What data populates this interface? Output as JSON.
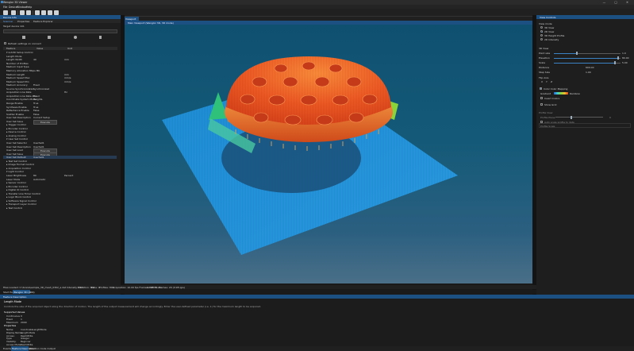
{
  "window": {
    "title": "Wenglor 3D Viewer",
    "controls": [
      "—",
      "□",
      "✕"
    ]
  },
  "menu": [
    "File",
    "Device",
    "Window",
    "Help"
  ],
  "left_panel": {
    "header": "Device Info",
    "tabs": [
      "Scanner",
      "Properties",
      "Feature Explorer"
    ],
    "target_label": "Target device",
    "target_value": "101",
    "search_placeholder": "",
    "toolbar_icons": [
      "save-icon",
      "load-icon",
      "execute-icon",
      "download-icon"
    ],
    "checkbox_label": "Refresh settings on connect",
    "columns": [
      "Feature",
      "Value",
      "Unit"
    ],
    "rows": [
      {
        "name": "▾ LLS3D Setup Control",
        "value": "",
        "unit": ""
      },
      {
        "name": "Length Mode",
        "value": "",
        "unit": ""
      },
      {
        "name": "Length Width",
        "value": "40",
        "unit": "mm"
      },
      {
        "name": "Number of Profiles",
        "value": "",
        "unit": ""
      },
      {
        "name": "Medium Input Type",
        "value": "",
        "unit": ""
      },
      {
        "name": "Memory Allocation Mbps Mb",
        "value": "",
        "unit": ""
      },
      {
        "name": "Medium Length",
        "value": "",
        "unit": "mm"
      },
      {
        "name": "Medium Speed Max",
        "value": "",
        "unit": "mm/s"
      },
      {
        "name": "Medium Speed Min",
        "value": "",
        "unit": "mm/s"
      },
      {
        "name": "Medium Accuracy",
        "value": "Fixed",
        "unit": ""
      },
      {
        "name": "Source Synchronization",
        "value": "Synchronized",
        "unit": ""
      },
      {
        "name": "Acquisition Line Rate",
        "value": "",
        "unit": "Hz"
      },
      {
        "name": "Acquisition Line Rate Abs",
        "value": "Fixed",
        "unit": ""
      },
      {
        "name": "Coordinate System Mode",
        "value": "Heights",
        "unit": ""
      },
      {
        "name": "Range Enable",
        "value": "True",
        "unit": ""
      },
      {
        "name": "Synthesis Enable",
        "value": "True",
        "unit": ""
      },
      {
        "name": "Reflectance Enable",
        "value": "False",
        "unit": ""
      },
      {
        "name": "Scatter Enable",
        "value": "False",
        "unit": ""
      },
      {
        "name": "User Set Description",
        "value": "Current Setup",
        "unit": ""
      },
      {
        "name": "User Set Save",
        "value": "Execute",
        "unit": ""
      },
      {
        "name": "▸ Trigger Control",
        "value": "",
        "unit": ""
      },
      {
        "name": "▸ Encoder Control",
        "value": "",
        "unit": ""
      },
      {
        "name": "▸ Device Control",
        "value": "",
        "unit": ""
      },
      {
        "name": "▸ Analog Control",
        "value": "",
        "unit": ""
      },
      {
        "name": "▾ User Set Control",
        "value": "",
        "unit": ""
      },
      {
        "name": "User Set Selector",
        "value": "UserSet1",
        "unit": ""
      },
      {
        "name": "User Set Description",
        "value": "UserSet1",
        "unit": ""
      },
      {
        "name": "User Set Load",
        "value": "Execute",
        "unit": ""
      },
      {
        "name": "User Set Save",
        "value": "Execute",
        "unit": ""
      },
      {
        "name": "User Set Default",
        "value": "UserSet1",
        "unit": ""
      },
      {
        "name": "▸ Test Set Control",
        "value": "",
        "unit": ""
      },
      {
        "name": "▸ Image Format Control",
        "value": "",
        "unit": ""
      },
      {
        "name": "▸ Acquisition Control",
        "value": "",
        "unit": ""
      },
      {
        "name": "▾ Light Control",
        "value": "",
        "unit": ""
      },
      {
        "name": "Laser Brightness",
        "value": "80",
        "unit": "Percent"
      },
      {
        "name": "Laser Mode",
        "value": "Automatic",
        "unit": ""
      },
      {
        "name": "▸ Sensor Control",
        "value": "",
        "unit": ""
      },
      {
        "name": "▸ Encoder Control",
        "value": "",
        "unit": ""
      },
      {
        "name": "▸ Digital IO Control",
        "value": "",
        "unit": ""
      },
      {
        "name": "▸ Transfer Line Timer Control",
        "value": "",
        "unit": ""
      },
      {
        "name": "▸ Logic Block Control",
        "value": "",
        "unit": ""
      },
      {
        "name": "▸ Software Signal Control",
        "value": "",
        "unit": ""
      },
      {
        "name": "▸ Transport Layer Control",
        "value": "",
        "unit": ""
      },
      {
        "name": "▸ Test Control",
        "value": "",
        "unit": ""
      }
    ],
    "selected_row": 29
  },
  "viewport": {
    "tab": "Viewport",
    "title": "Main Viewport (Wenglor 3D, 3D mode)"
  },
  "right_panel": {
    "header": "View Controls",
    "view_mode_label": "View mode",
    "view_modes": [
      "3D View",
      "2D View",
      "3D Height Profile",
      "2D Intensity"
    ],
    "view_mode_selected": 1,
    "settings_header": "3D View",
    "sliders": [
      {
        "label": "Point size",
        "value": "1.0",
        "fraction": 0.35
      },
      {
        "label": "Elevation",
        "value": "80.00",
        "fraction": 0.96
      },
      {
        "label": "Scale",
        "value": "5.00",
        "fraction": 0.92
      }
    ],
    "distance_label": "Distance",
    "distance_value": "600.00",
    "step_label": "Step Size",
    "step_value": "1.00",
    "flip_label": "Flip Axis",
    "flip_axes": [
      "X",
      "Y",
      "Z"
    ],
    "color_mapping_label": "Color Color Mapping",
    "color_from": "Gradient",
    "color_to": "Rainbow",
    "invert_label": "Invert Colors",
    "show_grid_label": "Show Grid",
    "profile_label": "Profile View",
    "profile_plane_label": "Profile Plane",
    "profile_value": "0",
    "auto_scale_label": "Auto scale profile to data",
    "scale_profile_label": "Profile Scale"
  },
  "status_bar": {
    "left": "Files Loaded: C:\\Scans\\sample_3D_mesh_0302_a.dat",
    "items": [
      "Intensity: 267",
      "Elevation: 441",
      "Trace: 0",
      "Profiles: 800",
      "Acquisition: 10.00 fps Frames: 28216",
      "12:45 Hours",
      "Frames: 29 (0.98 qps)"
    ],
    "tabs": [
      "Start Page",
      "Wenglor 3D (001)"
    ]
  },
  "bottom_panel": {
    "header": "Feature Description",
    "title": "Length Mode",
    "description": "Controls the size of the acquired object along the direction of motion. The length of the output measurement will change accordingly. Enter the user-defined parameter (i.e. 1) for the maximum length to be acquired.",
    "supported_label": "Supported Values",
    "supported": [
      {
        "k": "Continuous",
        "v": "0"
      },
      {
        "k": "Fixed",
        "v": "1"
      },
      {
        "k": "Maximum",
        "v": "2000"
      }
    ],
    "properties_label": "Properties",
    "properties": [
      {
        "k": "Name:",
        "v": "CoordinateLengthMode"
      },
      {
        "k": "Display Name:",
        "v": "Length Mode"
      },
      {
        "k": "Access:",
        "v": "Read/Write"
      },
      {
        "k": "Type:",
        "v": "IInteger"
      },
      {
        "k": "Visibility:",
        "v": "Beginner"
      },
      {
        "k": "Access Mode:",
        "v": "Read/Write"
      }
    ],
    "tabs": [
      "Events",
      "Feature Description",
      "Function Code Output"
    ]
  }
}
